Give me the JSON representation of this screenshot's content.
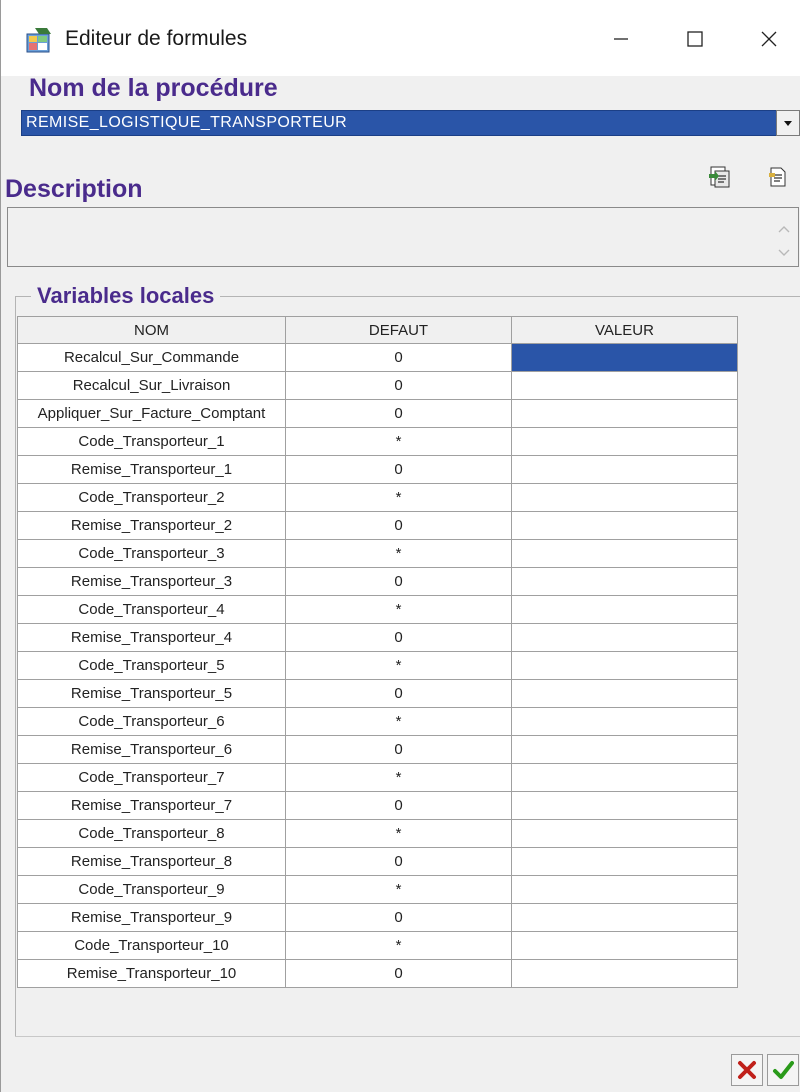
{
  "window": {
    "title": "Editeur de formules",
    "icon": "app-icon",
    "controls": [
      "minimize-icon",
      "maximize-icon",
      "close-icon"
    ]
  },
  "procedure": {
    "label": "Nom de la procédure",
    "selected_value": "REMISE_LOGISTIQUE_TRANSPORTEUR"
  },
  "description": {
    "label": "Description",
    "value": ""
  },
  "toolbar": {
    "icons": [
      "import-icon",
      "document-icon"
    ]
  },
  "variables": {
    "label": "Variables locales",
    "columns": [
      "NOM",
      "DEFAUT",
      "VALEUR"
    ],
    "rows": [
      {
        "nom": "Recalcul_Sur_Commande",
        "defaut": "0",
        "valeur": ""
      },
      {
        "nom": "Recalcul_Sur_Livraison",
        "defaut": "0",
        "valeur": ""
      },
      {
        "nom": "Appliquer_Sur_Facture_Comptant",
        "defaut": "0",
        "valeur": ""
      },
      {
        "nom": "Code_Transporteur_1",
        "defaut": "*",
        "valeur": ""
      },
      {
        "nom": "Remise_Transporteur_1",
        "defaut": "0",
        "valeur": ""
      },
      {
        "nom": "Code_Transporteur_2",
        "defaut": "*",
        "valeur": ""
      },
      {
        "nom": "Remise_Transporteur_2",
        "defaut": "0",
        "valeur": ""
      },
      {
        "nom": "Code_Transporteur_3",
        "defaut": "*",
        "valeur": ""
      },
      {
        "nom": "Remise_Transporteur_3",
        "defaut": "0",
        "valeur": ""
      },
      {
        "nom": "Code_Transporteur_4",
        "defaut": "*",
        "valeur": ""
      },
      {
        "nom": "Remise_Transporteur_4",
        "defaut": "0",
        "valeur": ""
      },
      {
        "nom": "Code_Transporteur_5",
        "defaut": "*",
        "valeur": ""
      },
      {
        "nom": "Remise_Transporteur_5",
        "defaut": "0",
        "valeur": ""
      },
      {
        "nom": "Code_Transporteur_6",
        "defaut": "*",
        "valeur": ""
      },
      {
        "nom": "Remise_Transporteur_6",
        "defaut": "0",
        "valeur": ""
      },
      {
        "nom": "Code_Transporteur_7",
        "defaut": "*",
        "valeur": ""
      },
      {
        "nom": "Remise_Transporteur_7",
        "defaut": "0",
        "valeur": ""
      },
      {
        "nom": "Code_Transporteur_8",
        "defaut": "*",
        "valeur": ""
      },
      {
        "nom": "Remise_Transporteur_8",
        "defaut": "0",
        "valeur": ""
      },
      {
        "nom": "Code_Transporteur_9",
        "defaut": "*",
        "valeur": ""
      },
      {
        "nom": "Remise_Transporteur_9",
        "defaut": "0",
        "valeur": ""
      },
      {
        "nom": "Code_Transporteur_10",
        "defaut": "*",
        "valeur": ""
      },
      {
        "nom": "Remise_Transporteur_10",
        "defaut": "0",
        "valeur": ""
      }
    ],
    "selected_row": 0,
    "selected_column": "VALEUR"
  },
  "buttons": {
    "cancel_icon": "cancel-icon",
    "ok_icon": "ok-icon"
  },
  "colors": {
    "label": "#4a2b8c",
    "selection": "#2a55a8",
    "cancel": "#c0201a",
    "ok": "#2a9a1a"
  }
}
